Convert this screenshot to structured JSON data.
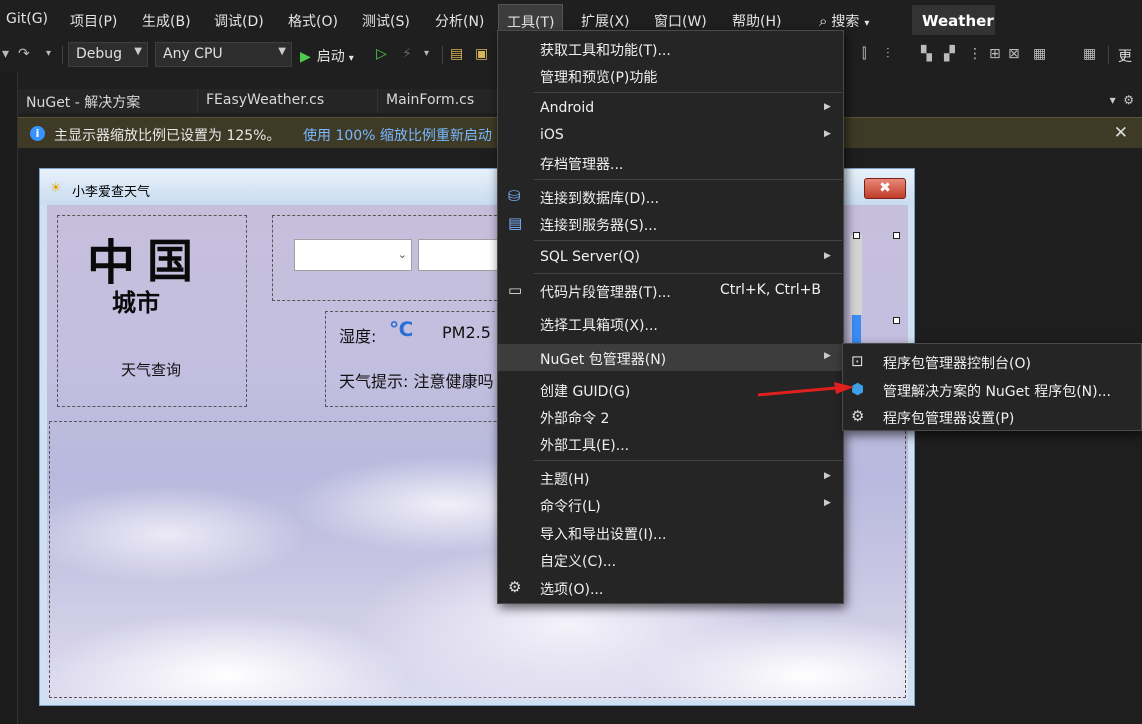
{
  "menubar": {
    "items": [
      "Git(G)",
      "项目(P)",
      "生成(B)",
      "调试(D)",
      "格式(O)",
      "测试(S)",
      "分析(N)",
      "工具(T)",
      "扩展(X)",
      "窗口(W)",
      "帮助(H)"
    ],
    "search": "搜索",
    "title": "Weather"
  },
  "toolbar": {
    "config": "Debug",
    "platform": "Any CPU",
    "start": "启动",
    "right_label": "更"
  },
  "tabs": [
    "NuGet - 解决方案",
    "FEasyWeather.cs",
    "MainForm.cs"
  ],
  "infobar": {
    "message": "主显示器缩放比例已设置为 125%。",
    "link": "使用 100% 缩放比例重新启动"
  },
  "form": {
    "title": "小李爱查天气",
    "logo_line1_a": "中",
    "logo_line1_b": "国",
    "logo_line2": "城市",
    "query_label": "天气查询",
    "humidity_label": "湿度:",
    "celsius": "℃",
    "pm_label": "PM2.5",
    "tip_label": "天气提示: 注意健康吗",
    "close_glyph": "✖"
  },
  "tools_menu": {
    "items": [
      {
        "label": "获取工具和功能(T)...",
        "icon": "",
        "shortcut": "",
        "submenu": false
      },
      {
        "label": "管理和预览(P)功能",
        "icon": "",
        "shortcut": "",
        "submenu": false
      },
      {
        "label": "Android",
        "icon": "",
        "shortcut": "",
        "submenu": true
      },
      {
        "label": "iOS",
        "icon": "",
        "shortcut": "",
        "submenu": true
      },
      {
        "label": "存档管理器...",
        "icon": "",
        "shortcut": "",
        "submenu": false
      },
      {
        "label": "连接到数据库(D)...",
        "icon": "database-connect-icon",
        "shortcut": "",
        "submenu": false
      },
      {
        "label": "连接到服务器(S)...",
        "icon": "server-connect-icon",
        "shortcut": "",
        "submenu": false
      },
      {
        "label": "SQL Server(Q)",
        "icon": "",
        "shortcut": "",
        "submenu": true
      },
      {
        "label": "代码片段管理器(T)...",
        "icon": "snippet-icon",
        "shortcut": "Ctrl+K, Ctrl+B",
        "submenu": false
      },
      {
        "label": "选择工具箱项(X)...",
        "icon": "",
        "shortcut": "",
        "submenu": false
      },
      {
        "label": "NuGet 包管理器(N)",
        "icon": "",
        "shortcut": "",
        "submenu": true
      },
      {
        "label": "创建 GUID(G)",
        "icon": "",
        "shortcut": "",
        "submenu": false
      },
      {
        "label": "外部命令 2",
        "icon": "",
        "shortcut": "",
        "submenu": false
      },
      {
        "label": "外部工具(E)...",
        "icon": "",
        "shortcut": "",
        "submenu": false
      },
      {
        "label": "主题(H)",
        "icon": "",
        "shortcut": "",
        "submenu": true
      },
      {
        "label": "命令行(L)",
        "icon": "",
        "shortcut": "",
        "submenu": true
      },
      {
        "label": "导入和导出设置(I)...",
        "icon": "",
        "shortcut": "",
        "submenu": false
      },
      {
        "label": "自定义(C)...",
        "icon": "",
        "shortcut": "",
        "submenu": false
      },
      {
        "label": "选项(O)...",
        "icon": "gear-icon",
        "shortcut": "",
        "submenu": false
      }
    ]
  },
  "nuget_submenu": {
    "items": [
      {
        "label": "程序包管理器控制台(O)",
        "icon": "console-icon"
      },
      {
        "label": "管理解决方案的 NuGet 程序包(N)...",
        "icon": "nuget-icon"
      },
      {
        "label": "程序包管理器设置(P)",
        "icon": "gear-icon"
      }
    ]
  },
  "colors": {
    "accent": "#3794ff",
    "menu_bg": "#252526",
    "highlight": "#3d3d3d",
    "arrow": "#e0201e"
  }
}
